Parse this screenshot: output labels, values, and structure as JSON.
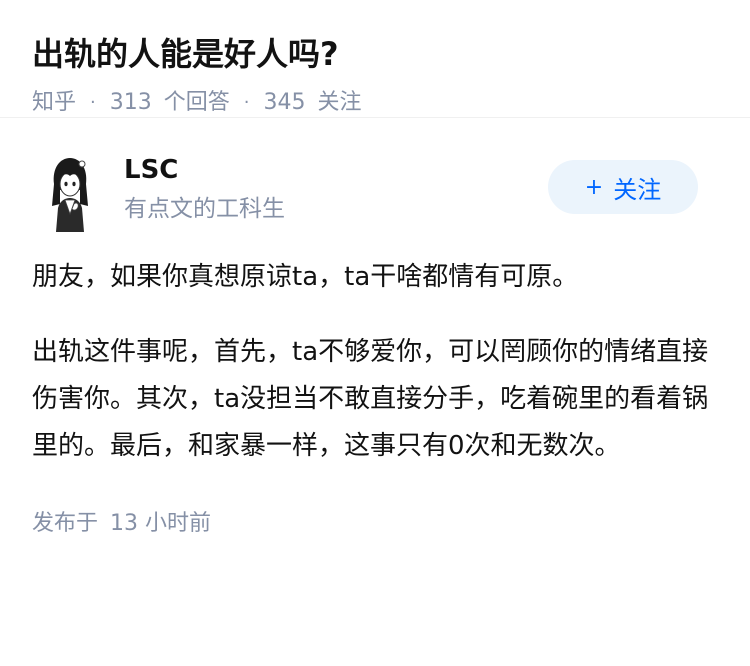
{
  "question": {
    "title": "出轨的人能是好人吗?",
    "source": "知乎",
    "answer_count": "313",
    "answer_label": "个回答",
    "follow_count": "345",
    "follow_label": "关注"
  },
  "answer": {
    "author": {
      "name": "LSC",
      "bio": "有点文的工科生",
      "avatar_icon": "avatar-anime-girl-icon"
    },
    "follow_button": {
      "icon": "plus-icon",
      "plus": "+",
      "label": "关注"
    },
    "paragraphs": [
      "朋友，如果你真想原谅ta，ta干啥都情有可原。",
      "出轨这件事呢，首先，ta不够爱你，可以罔顾你的情绪直接伤害你。其次，ta没担当不敢直接分手，吃着碗里的看着锅里的。最后，和家暴一样，这事只有0次和无数次。"
    ],
    "publish_label": "发布于",
    "publish_time": "13 小时前"
  },
  "colors": {
    "meta_gray": "#8590a6",
    "brand_blue": "#0066ff",
    "follow_bg": "#ebf4fc"
  }
}
